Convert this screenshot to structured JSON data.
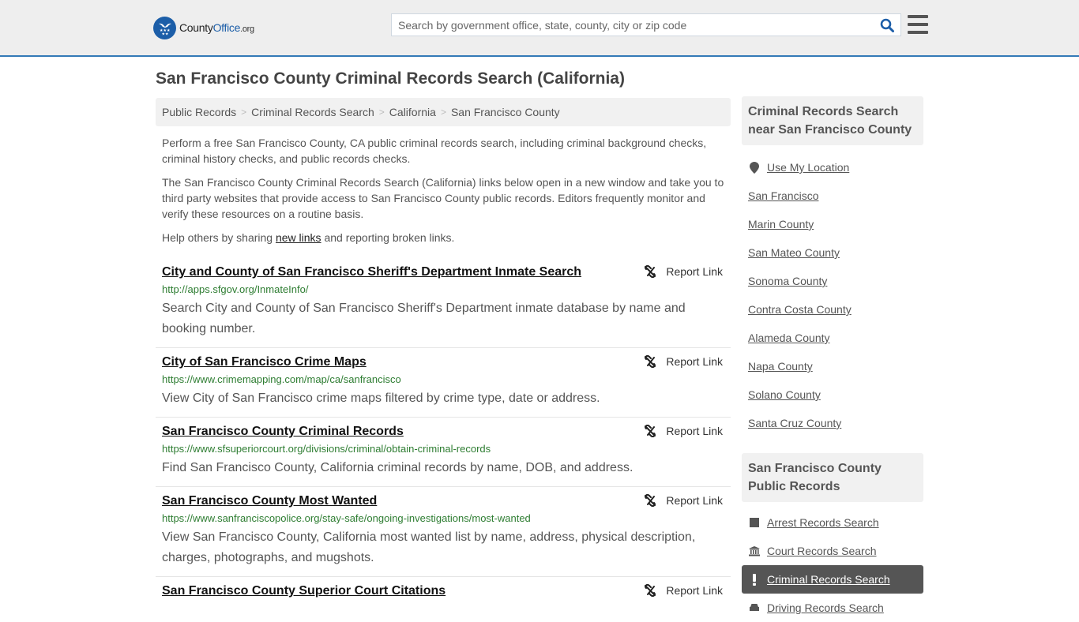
{
  "header": {
    "logo": {
      "prefix": "County",
      "brand": "Office",
      "tld": ".org"
    },
    "search_placeholder": "Search by government office, state, county, city or zip code",
    "search_value": "",
    "colors": {
      "accent": "#337ab7",
      "brand": "#1c5ea8"
    }
  },
  "page": {
    "title": "San Francisco County Criminal Records Search (California)"
  },
  "breadcrumb": [
    {
      "label": "Public Records"
    },
    {
      "label": "Criminal Records Search"
    },
    {
      "label": "California"
    },
    {
      "label": "San Francisco County"
    }
  ],
  "intro": {
    "p1": "Perform a free San Francisco County, CA public criminal records search, including criminal background checks, criminal history checks, and public records checks.",
    "p2": "The San Francisco County Criminal Records Search (California) links below open in a new window and take you to third party websites that provide access to San Francisco County public records. Editors frequently monitor and verify these resources on a routine basis.",
    "p3_before": "Help others by sharing ",
    "p3_link": "new links",
    "p3_after": " and reporting broken links."
  },
  "report_label": "Report Link",
  "results": [
    {
      "title": "City and County of San Francisco Sheriff's Department Inmate Search",
      "url": "http://apps.sfgov.org/InmateInfo/",
      "desc": "Search City and County of San Francisco Sheriff's Department inmate database by name and booking number."
    },
    {
      "title": "City of San Francisco Crime Maps",
      "url": "https://www.crimemapping.com/map/ca/sanfrancisco",
      "desc": "View City of San Francisco crime maps filtered by crime type, date or address."
    },
    {
      "title": "San Francisco County Criminal Records",
      "url": "https://www.sfsuperiorcourt.org/divisions/criminal/obtain-criminal-records",
      "desc": "Find San Francisco County, California criminal records by name, DOB, and address."
    },
    {
      "title": "San Francisco County Most Wanted",
      "url": "https://www.sanfranciscopolice.org/stay-safe/ongoing-investigations/most-wanted",
      "desc": "View San Francisco County, California most wanted list by name, address, physical description, charges, photographs, and mugshots."
    },
    {
      "title": "San Francisco County Superior Court Citations",
      "url": "",
      "desc": ""
    }
  ],
  "sidebar": {
    "nearby_heading": "Criminal Records Search near San Francisco County",
    "use_location": "Use My Location",
    "nearby": [
      "San Francisco",
      "Marin County",
      "San Mateo County",
      "Sonoma County",
      "Contra Costa County",
      "Alameda County",
      "Napa County",
      "Solano County",
      "Santa Cruz County"
    ],
    "records_heading": "San Francisco County Public Records",
    "records": [
      {
        "label": "Arrest Records Search",
        "icon": "square-icon",
        "active": false
      },
      {
        "label": "Court Records Search",
        "icon": "courthouse-icon",
        "active": false
      },
      {
        "label": "Criminal Records Search",
        "icon": "exclamation-icon",
        "active": true
      },
      {
        "label": "Driving Records Search",
        "icon": "car-icon",
        "active": false
      }
    ]
  }
}
